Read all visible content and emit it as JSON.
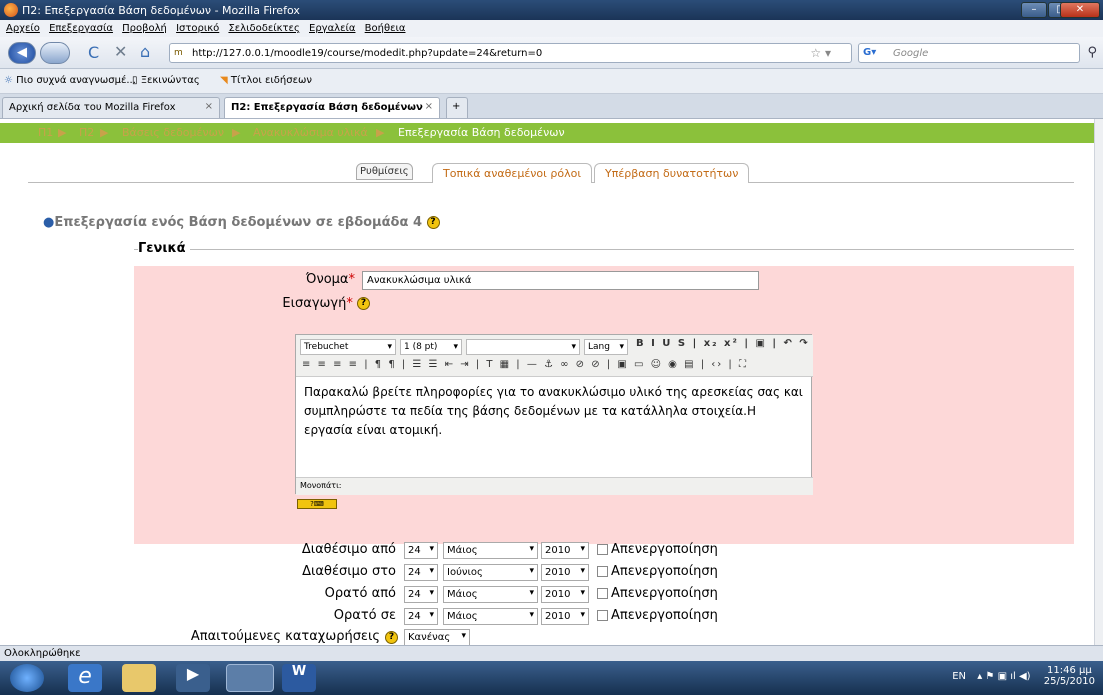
{
  "window": {
    "title": "Π2: Επεξεργασία Βάση δεδομένων - Mozilla Firefox"
  },
  "menu": [
    "Αρχείο",
    "Επεξεργασία",
    "Προβολή",
    "Ιστορικό",
    "Σελιδοδείκτες",
    "Εργαλεία",
    "Βοήθεια"
  ],
  "nav": {
    "url": "http://127.0.0.1/moodle19/course/modedit.php?update=24&return=0",
    "search_placeholder": "Google"
  },
  "bookmarks": [
    "Πιο συχνά αναγνωσμέ...",
    "Ξεκινώντας",
    "Τίτλοι ειδήσεων"
  ],
  "tabs": [
    {
      "label": "Αρχική σελίδα του Mozilla Firefox"
    },
    {
      "label": "Π2: Επεξεργασία Βάση δεδομένων"
    }
  ],
  "breadcrumb": [
    "Π1",
    "Π2",
    "Βάσεις δεδομένων",
    "Ανακυκλώσιμα υλικά",
    "Επεξεργασία Βάση δεδομένων"
  ],
  "page_tabs": [
    "Ρυθμίσεις",
    "Τοπικά αναθεμένοι ρόλοι",
    "Υπέρβαση δυνατοτήτων"
  ],
  "heading": "Επεξεργασία ενός Βάση δεδομένων σε εβδομάδα 4",
  "section": "Γενικά",
  "form": {
    "name_label": "Όνομα",
    "name_value": "Ανακυκλώσιμα υλικά",
    "intro_label": "Εισαγωγή",
    "editor": {
      "font": "Trebuchet",
      "size": "1 (8 pt)",
      "lang": "Lang",
      "text": "Παρακαλώ βρείτε πληροφορίες για το ανακυκλώσιμο υλικό της αρεσκείας σας και συμπληρώστε τα πεδία της βάσης δεδομένων με τα κατάλληλα στοιχεία.Η εργασία είναι ατομική.",
      "path_label": "Μονοπάτι:"
    },
    "dates": [
      {
        "label": "Διαθέσιμο από",
        "day": "24",
        "month": "Μάιος",
        "year": "2010",
        "disable": "Απενεργοποίηση"
      },
      {
        "label": "Διαθέσιμο στο",
        "day": "24",
        "month": "Ιούνιος",
        "year": "2010",
        "disable": "Απενεργοποίηση"
      },
      {
        "label": "Ορατό από",
        "day": "24",
        "month": "Μάιος",
        "year": "2010",
        "disable": "Απενεργοποίηση"
      },
      {
        "label": "Ορατό σε",
        "day": "24",
        "month": "Μάιος",
        "year": "2010",
        "disable": "Απενεργοποίηση"
      }
    ],
    "required_entries_label": "Απαιτούμενες καταχωρήσεις",
    "required_entries_value": "Κανένας"
  },
  "status": "Ολοκληρώθηκε",
  "tray": {
    "lang": "EN",
    "time": "11:46 μμ",
    "date": "25/5/2010"
  }
}
